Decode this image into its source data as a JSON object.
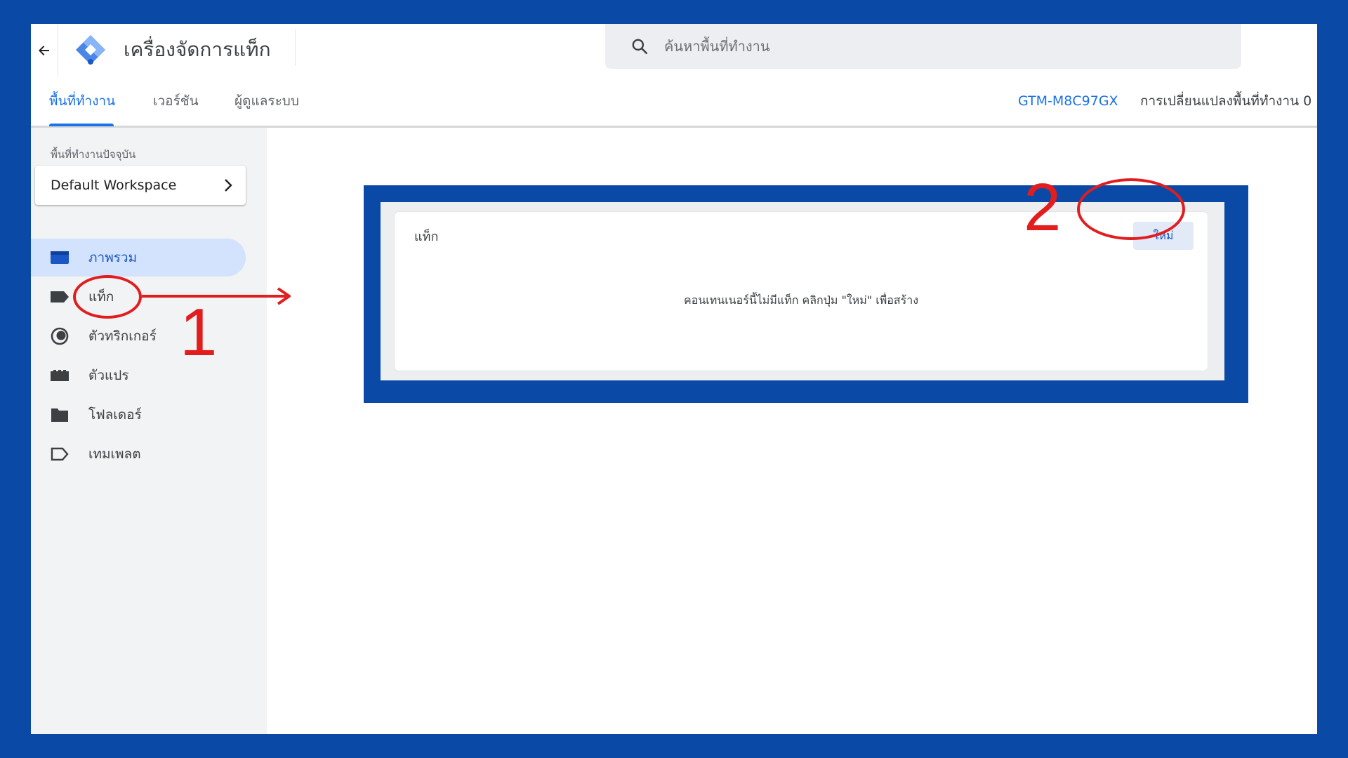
{
  "header": {
    "app_title": "เครื่องจัดการแท็ก",
    "search_placeholder": "ค้นหาพื้นที่ทำงาน"
  },
  "tabs": [
    {
      "label": "พื้นที่ทำงาน",
      "active": true
    },
    {
      "label": "เวอร์ชัน",
      "active": false
    },
    {
      "label": "ผู้ดูแลระบบ",
      "active": false
    }
  ],
  "container_id": "GTM-M8C97GX",
  "workspace_changes": "การเปลี่ยนแปลงพื้นที่ทำงาน 0",
  "sidebar": {
    "workspace_label": "พื้นที่ทำงานปัจจุบัน",
    "workspace_name": "Default Workspace",
    "items": [
      {
        "label": "ภาพรวม",
        "icon": "overview-icon",
        "active": true
      },
      {
        "label": "แท็ก",
        "icon": "tag-icon",
        "active": false
      },
      {
        "label": "ตัวทริกเกอร์",
        "icon": "trigger-icon",
        "active": false
      },
      {
        "label": "ตัวแปร",
        "icon": "variable-icon",
        "active": false
      },
      {
        "label": "โฟลเดอร์",
        "icon": "folder-icon",
        "active": false
      },
      {
        "label": "เทมเพลต",
        "icon": "template-icon",
        "active": false
      }
    ]
  },
  "main": {
    "card_title": "แท็ก",
    "new_button": "ใหม่",
    "empty_message": "คอนเทนเนอร์นี้ไม่มีแท็ก คลิกปุ่ม \"ใหม่\" เพื่อสร้าง"
  },
  "annotations": {
    "step_1": "1",
    "step_2": "2",
    "color": "#e11d1d"
  },
  "colors": {
    "frame_blue": "#0a4aa6",
    "accent": "#1a73e8"
  }
}
